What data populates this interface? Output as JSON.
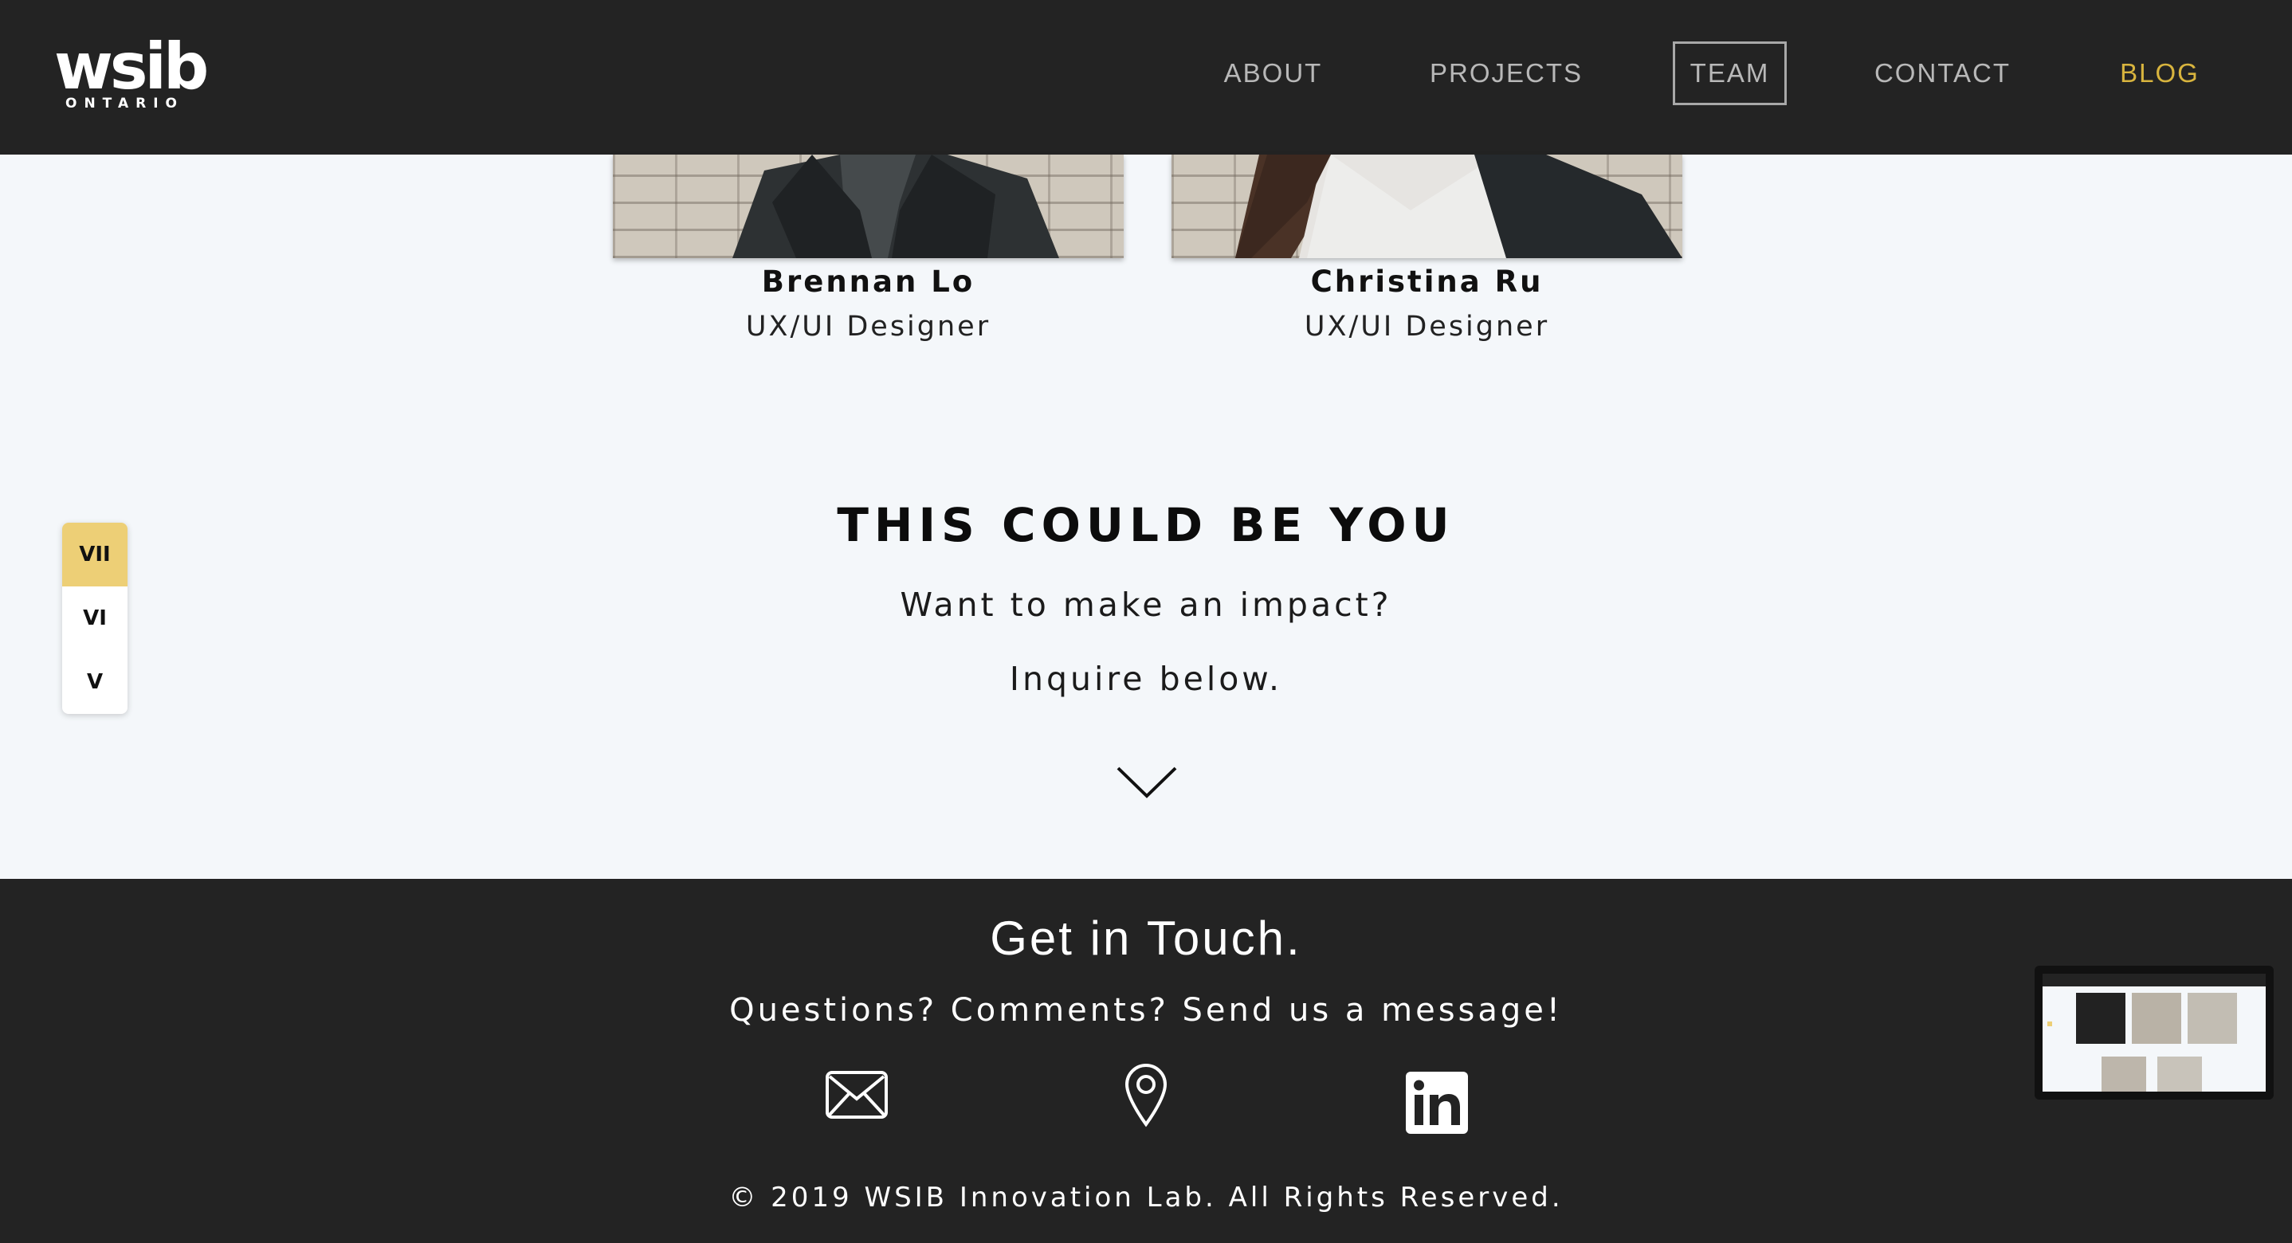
{
  "header": {
    "logo_main": "wsib",
    "logo_sub": "ONTARIO",
    "nav": [
      {
        "label": "ABOUT"
      },
      {
        "label": "PROJECTS"
      },
      {
        "label": "TEAM"
      },
      {
        "label": "CONTACT"
      },
      {
        "label": "BLOG"
      }
    ],
    "active": "TEAM"
  },
  "team": [
    {
      "name": "Brennan Lo",
      "role": "UX/UI Designer"
    },
    {
      "name": "Christina Ru",
      "role": "UX/UI Designer"
    }
  ],
  "section_nav": {
    "items": [
      "VII",
      "VI",
      "V"
    ],
    "active": "VII"
  },
  "cta": {
    "title": "THIS COULD BE YOU",
    "line1": "Want to make an impact?",
    "line2": "Inquire below.",
    "icon": "chevron-down-icon"
  },
  "footer": {
    "title": "Get in Touch.",
    "subtitle": "Questions? Comments? Send us a message!",
    "icons": [
      "mail-icon",
      "location-pin-icon",
      "linkedin-icon"
    ],
    "copyright": "© 2019 WSIB Innovation Lab. All Rights Reserved."
  },
  "colors": {
    "header_bg": "#232323",
    "page_bg": "#f4f7fa",
    "accent_gold": "#d8b43e",
    "active_section": "#edcf76"
  }
}
